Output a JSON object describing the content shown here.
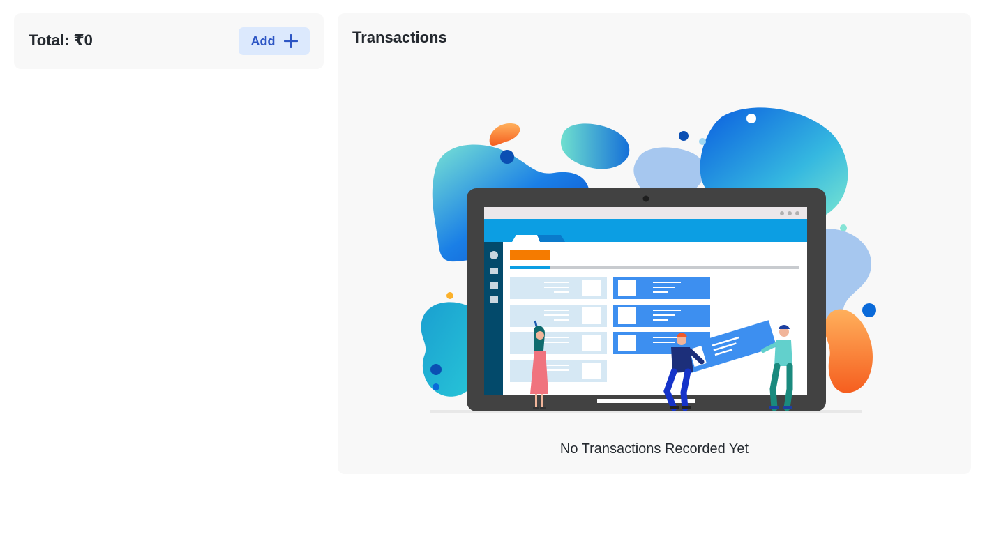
{
  "summary": {
    "total_label": "Total: ₹0",
    "add_label": "Add"
  },
  "transactions": {
    "title": "Transactions",
    "empty_message": "No Transactions Recorded Yet"
  },
  "icons": {
    "add": "plus-icon",
    "illustration": "empty-transactions-illustration"
  },
  "colors": {
    "accent": "#2c55c4",
    "button_bg": "#dce9fd",
    "card_bg": "#f8f8f8"
  }
}
